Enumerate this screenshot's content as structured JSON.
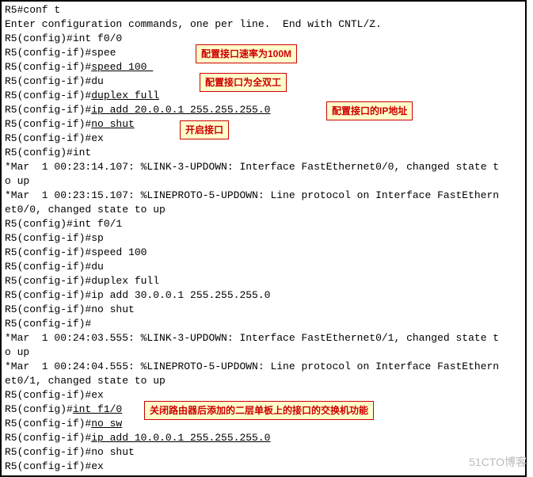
{
  "lines": {
    "l0": "R5#conf t",
    "l1": "Enter configuration commands, one per line.  End with CNTL/Z.",
    "l2": "R5(config)#int f0/0",
    "l3": "R5(config-if)#spee",
    "l4a": "R5(config-if)#",
    "l4b": "speed 100 ",
    "l5": "R5(config-if)#du",
    "l6a": "R5(config-if)#",
    "l6b": "duplex full",
    "l7a": "R5(config-if)#",
    "l7b": "ip add 20.0.0.1 255.255.255.0",
    "l8a": "R5(config-if)#",
    "l8b": "no shut",
    "l9": "R5(config-if)#ex",
    "l10": "R5(config)#int",
    "l11": "*Mar  1 00:23:14.107: %LINK-3-UPDOWN: Interface FastEthernet0/0, changed state t",
    "l12": "o up",
    "l13": "*Mar  1 00:23:15.107: %LINEPROTO-5-UPDOWN: Line protocol on Interface FastEthern",
    "l14": "et0/0, changed state to up",
    "l15": "R5(config)#int f0/1",
    "l16": "R5(config-if)#sp",
    "l17": "R5(config-if)#speed 100",
    "l18": "R5(config-if)#du",
    "l19": "R5(config-if)#duplex full",
    "l20": "R5(config-if)#ip add 30.0.0.1 255.255.255.0",
    "l21": "R5(config-if)#no shut",
    "l22": "R5(config-if)#",
    "l23": "*Mar  1 00:24:03.555: %LINK-3-UPDOWN: Interface FastEthernet0/1, changed state t",
    "l24": "o up",
    "l25": "*Mar  1 00:24:04.555: %LINEPROTO-5-UPDOWN: Line protocol on Interface FastEthern",
    "l26": "et0/1, changed state to up",
    "l27": "R5(config-if)#ex",
    "l28a": "R5(config)#",
    "l28b": "int f1/0",
    "l29a": "R5(config-if)#",
    "l29b": "no sw",
    "l30a": "R5(config-if)#",
    "l30b": "ip add 10.0.0.1 255.255.255.0",
    "l31": "R5(config-if)#no shut",
    "l32": "R5(config-if)#ex"
  },
  "annotations": {
    "a1": "配置接口速率为100M",
    "a2": "配置接口为全双工",
    "a3": "配置接口的IP地址",
    "a4": "开启接口",
    "a5": "关闭路由器后添加的二层单板上的接口的交换机功能"
  },
  "watermark": "51CTO博客"
}
